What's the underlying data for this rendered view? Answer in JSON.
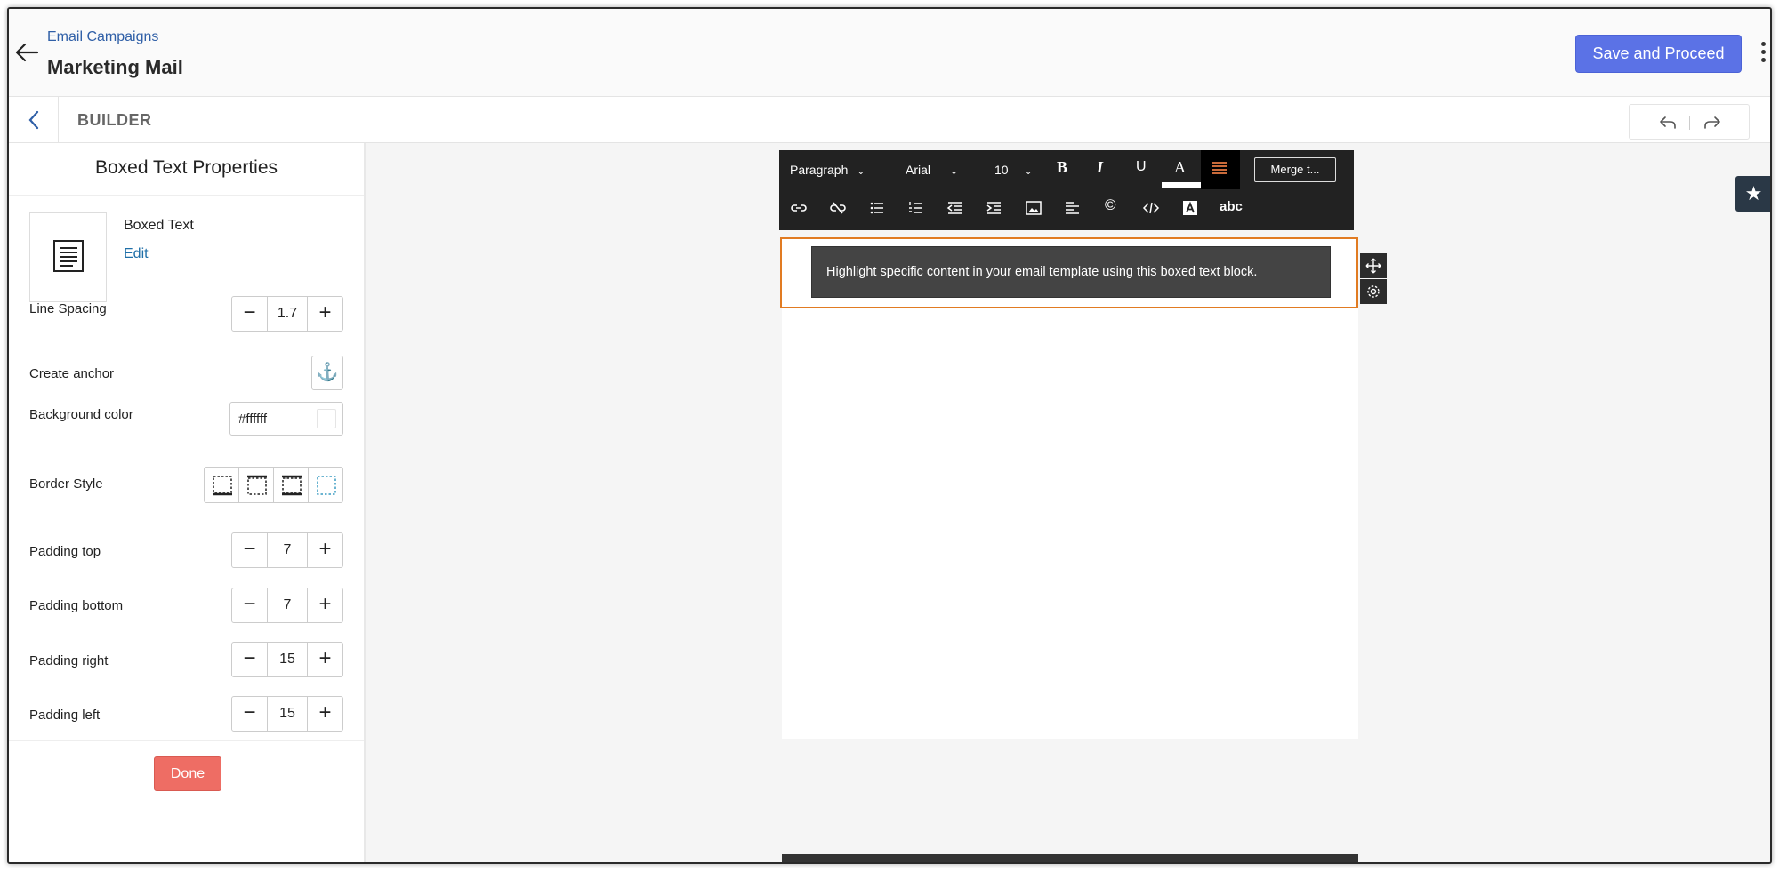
{
  "header": {
    "breadcrumb": "Email Campaigns",
    "title": "Marketing Mail",
    "save_label": "Save and Proceed"
  },
  "builder": {
    "title": "BUILDER"
  },
  "panel": {
    "title": "Boxed Text Properties",
    "block_name": "Boxed Text",
    "edit_label": "Edit",
    "line_spacing": {
      "label": "Line Spacing",
      "value": "1.7"
    },
    "anchor": {
      "label": "Create anchor",
      "icon": "⚓"
    },
    "background": {
      "label": "Background color",
      "value": "#ffffff"
    },
    "border": {
      "label": "Border Style"
    },
    "padding_top": {
      "label": "Padding top",
      "value": "7"
    },
    "padding_bottom": {
      "label": "Padding bottom",
      "value": "7"
    },
    "padding_right": {
      "label": "Padding right",
      "value": "15"
    },
    "padding_left": {
      "label": "Padding left",
      "value": "15"
    },
    "done_label": "Done"
  },
  "toolbar": {
    "format": "Paragraph",
    "font": "Arial",
    "size": "10",
    "bold": "B",
    "italic": "I",
    "underline": "U",
    "font_color": "A",
    "merge": "Merge t...",
    "copyright": "©",
    "spellcheck": "abc"
  },
  "content": {
    "boxed_text": "Highlight specific content in your email template using this boxed text block."
  },
  "colors": {
    "accent": "#5b72e6",
    "done": "#ee6d64",
    "selection": "#e17b22"
  }
}
